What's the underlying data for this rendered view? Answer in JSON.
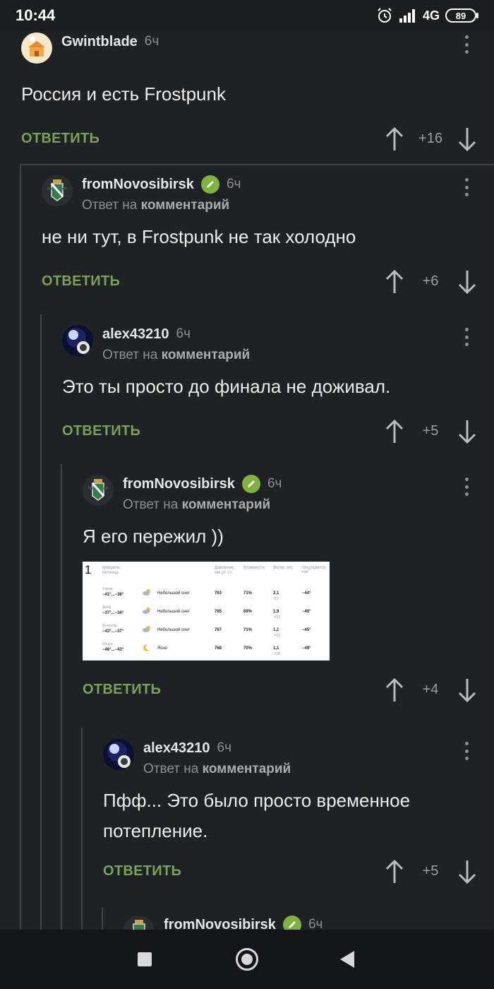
{
  "status_bar": {
    "time": "10:44",
    "network": "4G",
    "battery": "89"
  },
  "reply_label": "ОТВЕТИТЬ",
  "reply_to_prefix": "Ответ на",
  "reply_to_target": "комментарий",
  "comments": [
    {
      "author": "Gwintblade",
      "time": "6ч",
      "text": "Россия и есть Frostpunk",
      "score": "+16"
    },
    {
      "author": "fromNovosibirsk",
      "time": "6ч",
      "text": "не ни тут, в Frostpunk не так холодно",
      "score": "+6"
    },
    {
      "author": "alex43210",
      "time": "6ч",
      "text": "Это ты просто до финала не доживал.",
      "score": "+5"
    },
    {
      "author": "fromNovosibirsk",
      "time": "6ч",
      "text": "Я его пережил ))",
      "score": "+4",
      "image": {
        "index": "1",
        "headers": [
          "февраль,",
          "пятница",
          "Давление,",
          "мм рт. ст.",
          "Влажность",
          "Ветер, м/с",
          "Ощущается как"
        ],
        "rows": [
          {
            "period": "Утром",
            "temp": "−41°...−38°",
            "desc": "Небольшой снег",
            "pressure": "763",
            "humidity": "71%",
            "wind": "2,1",
            "wind_dir": "Ю",
            "feels": "−44°"
          },
          {
            "period": "Днём",
            "temp": "−37°...−34°",
            "desc": "Небольшой снег",
            "pressure": "765",
            "humidity": "69%",
            "wind": "1,9",
            "wind_dir": "ЮЗ",
            "feels": "−40°"
          },
          {
            "period": "Вечером",
            "temp": "−43°...−37°",
            "desc": "Небольшой снег",
            "pressure": "767",
            "humidity": "71%",
            "wind": "1,1",
            "wind_dir": "ЮЗ",
            "feels": "−45°"
          },
          {
            "period": "Ночью",
            "temp": "−46°...−43°",
            "desc": "Ясно",
            "pressure": "768",
            "humidity": "70%",
            "wind": "1,1",
            "wind_dir": "ЮВ",
            "feels": "−49°"
          }
        ]
      }
    },
    {
      "author": "alex43210",
      "time": "6ч",
      "text": "Пфф... Это было просто временное потепление.",
      "score": "+5"
    },
    {
      "author": "fromNovosibirsk",
      "time": "6ч"
    }
  ],
  "colors": {
    "background": "#1f2225",
    "reply": "#7c9f5a",
    "badge": "#7fb23f",
    "thread_line": "#3d4247"
  }
}
